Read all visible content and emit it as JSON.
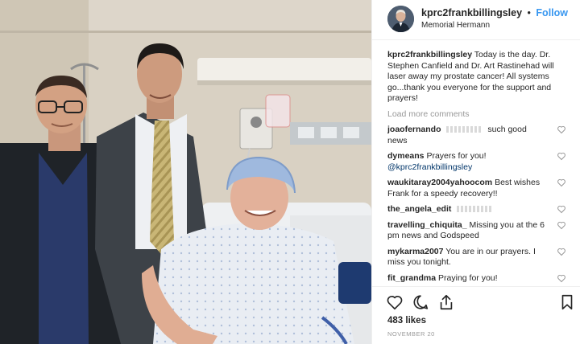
{
  "post": {
    "photo_alt": "Patient in hospital gown and surgical cap with two doctors in a hospital room",
    "header": {
      "username": "kprc2frankbillingsley",
      "separator": "•",
      "follow_label": "Follow",
      "location": "Memorial Hermann"
    },
    "caption": {
      "username": "kprc2frankbillingsley",
      "text": "Today is the day. Dr. Stephen Canfield and Dr. Art Rastinehad will laser away my prostate cancer! All systems go...thank you everyone for the support and prayers!"
    },
    "load_more_label": "Load more comments",
    "comments": [
      {
        "username": "joaofernando",
        "text": "such good news"
      },
      {
        "username": "dymeans",
        "text": "Prayers for you!",
        "mention": "@kprc2frankbillingsley"
      },
      {
        "username": "waukitaray2004yahoocom",
        "text": "Best wishes Frank for a speedy recovery!!"
      },
      {
        "username": "the_angela_edit",
        "text": ""
      },
      {
        "username": "travelling_chiquita_",
        "text": "Missing you at the 6 pm news and Godspeed"
      },
      {
        "username": "mykarma2007",
        "text": "You are in our prayers. I miss you tonight."
      },
      {
        "username": "fit_grandma",
        "text": "Praying for you!"
      }
    ],
    "actions": {
      "like_icon": "heart-icon",
      "comment_icon": "comment-icon",
      "share_icon": "share-icon",
      "save_icon": "bookmark-icon"
    },
    "likes": "483 likes",
    "date": "NOVEMBER 20",
    "colors": {
      "link_blue": "#3897f0",
      "text": "#262626",
      "muted": "#999999",
      "border": "#efefef"
    }
  }
}
